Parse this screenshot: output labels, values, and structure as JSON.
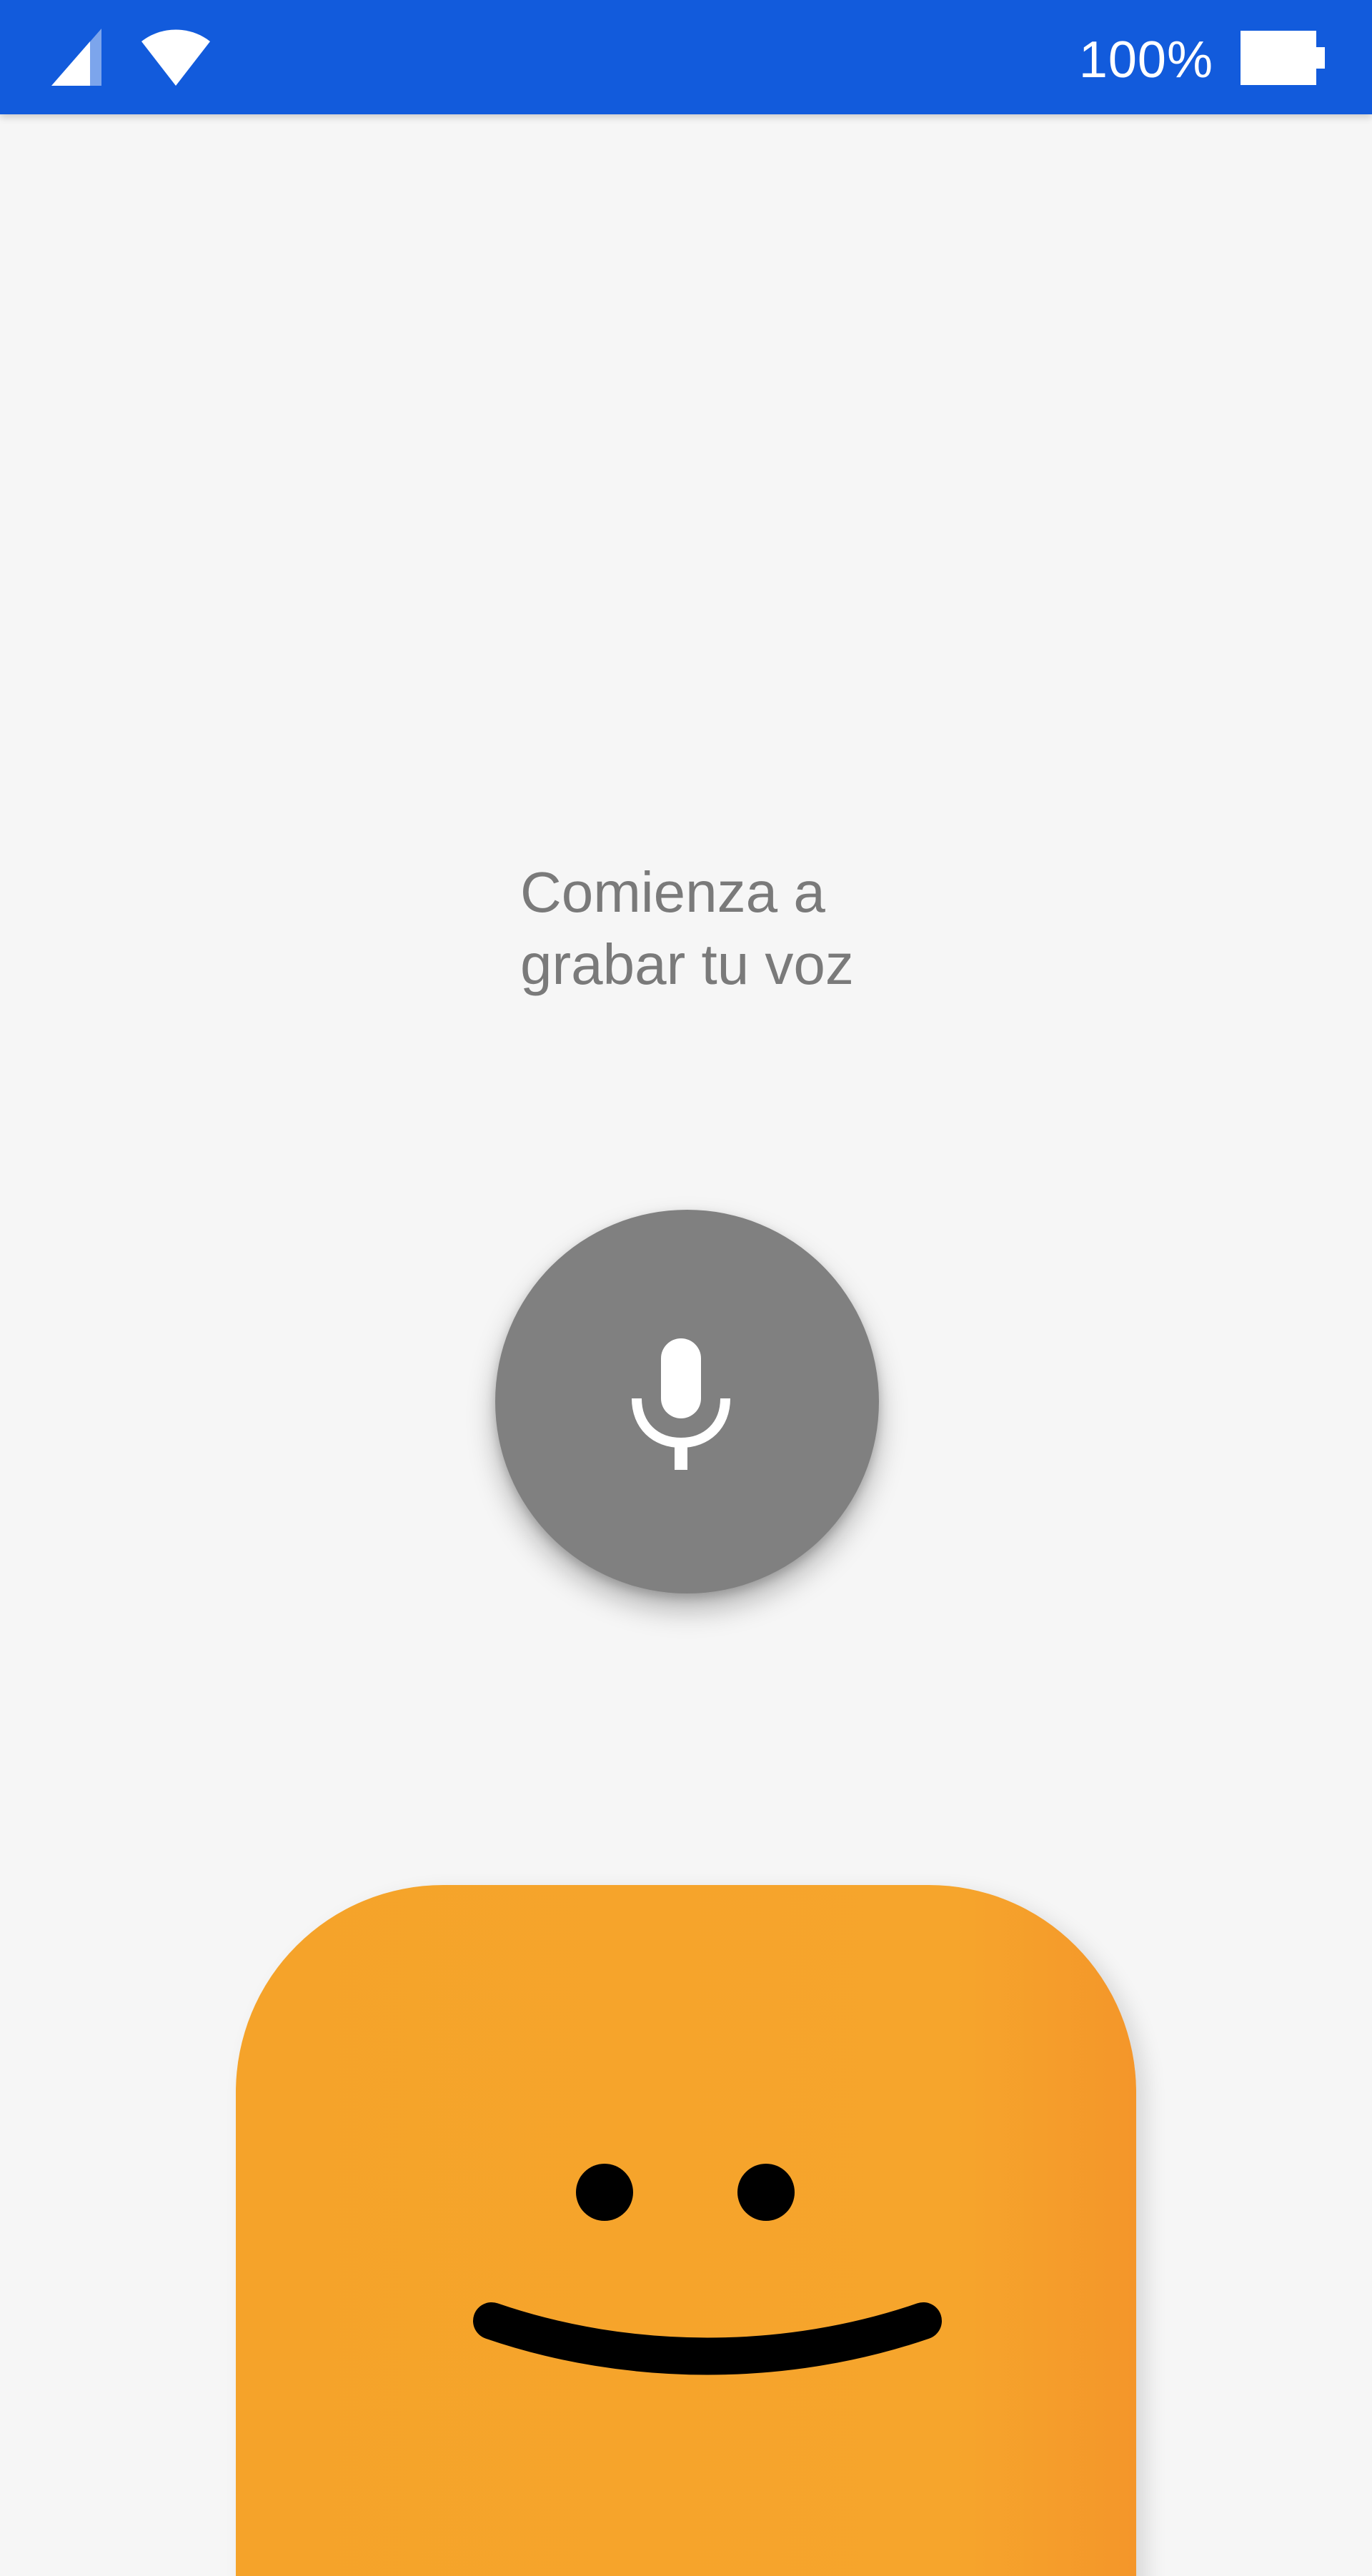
{
  "status_bar": {
    "battery_percent": "100%",
    "battery_level": 1.0,
    "signal_icon": "cellular-signal-icon",
    "wifi_icon": "wifi-icon",
    "battery_icon": "battery-full-icon",
    "background_color": "#125bdc"
  },
  "main": {
    "prompt_line_1": "Comienza a",
    "prompt_line_2": "grabar tu voz",
    "mic_button_icon": "microphone-icon",
    "mic_button_color": "#808080"
  },
  "mascot": {
    "expression": "smiling-face",
    "color": "#f5a32a"
  }
}
